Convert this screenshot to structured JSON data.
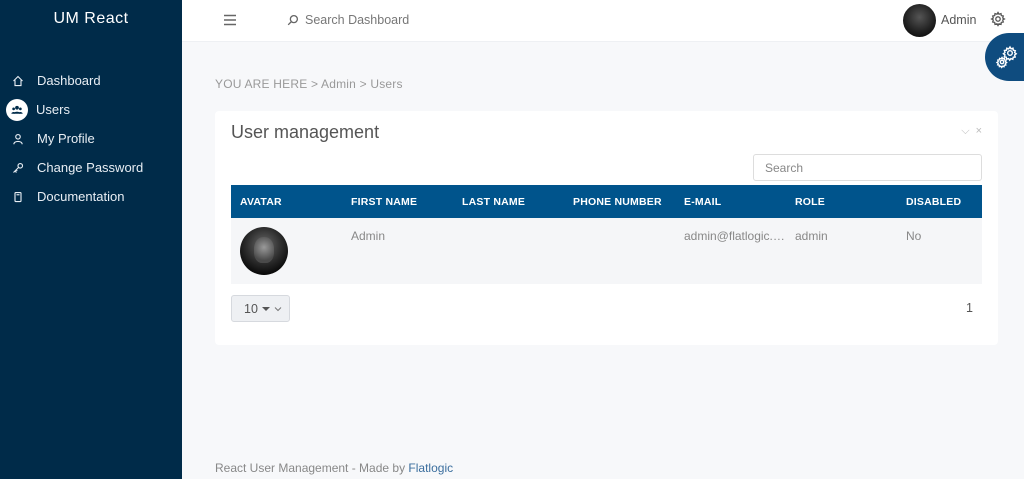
{
  "app": {
    "logo": "UM React"
  },
  "sidebar": {
    "items": [
      {
        "label": "Dashboard",
        "icon": "home-icon",
        "active": false
      },
      {
        "label": "Users",
        "icon": "users-icon",
        "active": true
      },
      {
        "label": "My Profile",
        "icon": "user-icon",
        "active": false
      },
      {
        "label": "Change Password",
        "icon": "key-icon",
        "active": false
      },
      {
        "label": "Documentation",
        "icon": "book-icon",
        "active": false
      }
    ]
  },
  "header": {
    "search_placeholder": "Search Dashboard",
    "user_name": "Admin"
  },
  "breadcrumb": "YOU ARE HERE > Admin > Users",
  "card": {
    "title": "User management",
    "controls": {
      "collapse": "⌵",
      "close": "×"
    },
    "search_placeholder": "Search",
    "columns": [
      "AVATAR",
      "FIRST NAME",
      "LAST NAME",
      "PHONE NUMBER",
      "E-MAIL",
      "ROLE",
      "DISABLED"
    ],
    "rows": [
      {
        "first_name": "Admin",
        "last_name": "",
        "phone": "",
        "email": "admin@flatlogic.com",
        "role": "admin",
        "disabled": "No"
      }
    ],
    "page_size": "10",
    "current_page": "1"
  },
  "footer": {
    "text": "React User Management - Made by ",
    "link": "Flatlogic"
  },
  "colors": {
    "sidebar": "#002b49",
    "table_header": "#00548c",
    "accent": "#0f4c7f"
  }
}
